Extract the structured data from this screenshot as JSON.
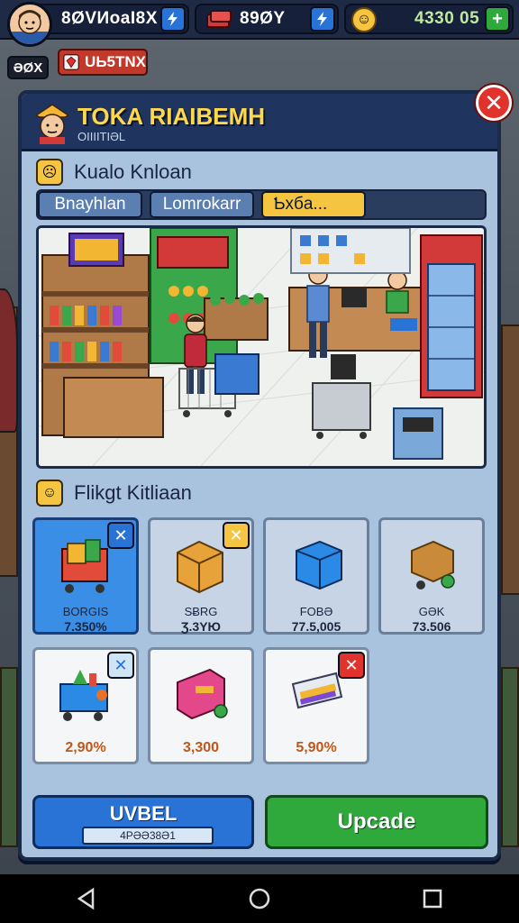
{
  "hud": {
    "player_stat": "8ØVИoaI8X",
    "cash": "89ØY",
    "coins": "4330 05",
    "level_chip": "ƏØX",
    "gem_label": "UЬ5TNX",
    "plus1": "+",
    "plus2": "+",
    "plus3": "+"
  },
  "panel": {
    "title": "TOKA RIAIBEMH",
    "subtitle": "OIIIITIƏL",
    "close": "✕",
    "section_one": "Kualo Knloan",
    "tabs": [
      {
        "label": "Bnayhlan"
      },
      {
        "label": "Lomrokarr"
      },
      {
        "label": "Ƅxбa..."
      }
    ],
    "section_two": "Flikgt Kitliaan",
    "items_row1": [
      {
        "name": "BORGIS",
        "value": "7.350%",
        "badge": "✕",
        "icon": "shopping-cart-icon"
      },
      {
        "name": "SɃRG",
        "value": "Ʒ.3YЮ",
        "badge": "✕",
        "icon": "cardboard-box-icon"
      },
      {
        "name": "FOBƏ",
        "value": "77.5,005",
        "badge": "",
        "icon": "blue-box-icon"
      },
      {
        "name": "GƏK",
        "value": "73.506",
        "badge": "",
        "icon": "hand-truck-icon"
      }
    ],
    "items_row2": [
      {
        "value": "2,90%",
        "badge": "✕",
        "icon": "vegetable-cart-icon"
      },
      {
        "value": "3,300",
        "badge": "",
        "icon": "gift-box-icon"
      },
      {
        "value": "5,90%",
        "badge": "✕",
        "icon": "card-reader-icon"
      }
    ]
  },
  "bottom": {
    "level_title": "UVBEL",
    "level_bar": "4PƏƏ38Ə1",
    "upgrade": "Upcade"
  },
  "colors": {
    "accent_blue": "#2a73d6",
    "accent_green": "#2fa83c",
    "close_red": "#e2322c",
    "title_yellow": "#ffd84a"
  }
}
